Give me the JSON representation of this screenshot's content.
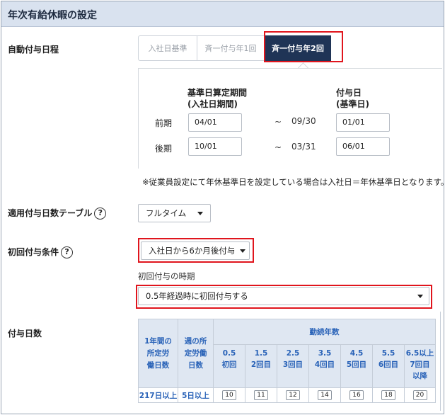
{
  "header": {
    "title": "年次有給休暇の設定"
  },
  "auto_grant": {
    "label": "自動付与日程",
    "tabs": [
      {
        "label": "入社日基準",
        "selected": false
      },
      {
        "label": "斉一付与年1回",
        "selected": false
      },
      {
        "label": "斉一付与年2回",
        "selected": true
      }
    ],
    "col_period": [
      "基準日算定期間",
      "(入社日期間)"
    ],
    "col_grant": [
      "付与日",
      "(基準日)"
    ],
    "rows": [
      {
        "label": "前期",
        "start": "04/01",
        "tilde": "~",
        "end": "09/30",
        "grant": "01/01"
      },
      {
        "label": "後期",
        "start": "10/01",
        "tilde": "~",
        "end": "03/31",
        "grant": "06/01"
      }
    ],
    "note": "※従業員設定にて年休基準日を設定している場合は入社日＝年休基準日となります。"
  },
  "table_select": {
    "label": "適用付与日数テーブル",
    "help": "?",
    "value": "フルタイム"
  },
  "first_grant": {
    "label": "初回付与条件",
    "help": "?",
    "value": "入社日から6か月後付与",
    "timing_label": "初回付与の時期",
    "timing_value": "0.5年経過時に初回付与する"
  },
  "grant_days": {
    "label": "付与日数",
    "col1": [
      "1年間の",
      "所定労",
      "働日数"
    ],
    "col2": [
      "週の所",
      "定労働",
      "日数"
    ],
    "tenure_header": "勤続年数",
    "tenures": [
      {
        "years": "0.5",
        "nth": "初回"
      },
      {
        "years": "1.5",
        "nth": "2回目"
      },
      {
        "years": "2.5",
        "nth": "3回目"
      },
      {
        "years": "3.5",
        "nth": "4回目"
      },
      {
        "years": "4.5",
        "nth": "5回目"
      },
      {
        "years": "5.5",
        "nth": "6回目"
      },
      {
        "years": "6.5以上",
        "nth": "7回目以降"
      }
    ],
    "row": {
      "annual": "217日以上",
      "weekly": "5日以上",
      "days": [
        "10",
        "11",
        "12",
        "14",
        "16",
        "18",
        "20"
      ]
    }
  },
  "colors": {
    "header_bg": "#d9e2ef",
    "selected_tab": "#1f3456",
    "highlight": "#e0151d",
    "table_text": "#2a63b8"
  }
}
